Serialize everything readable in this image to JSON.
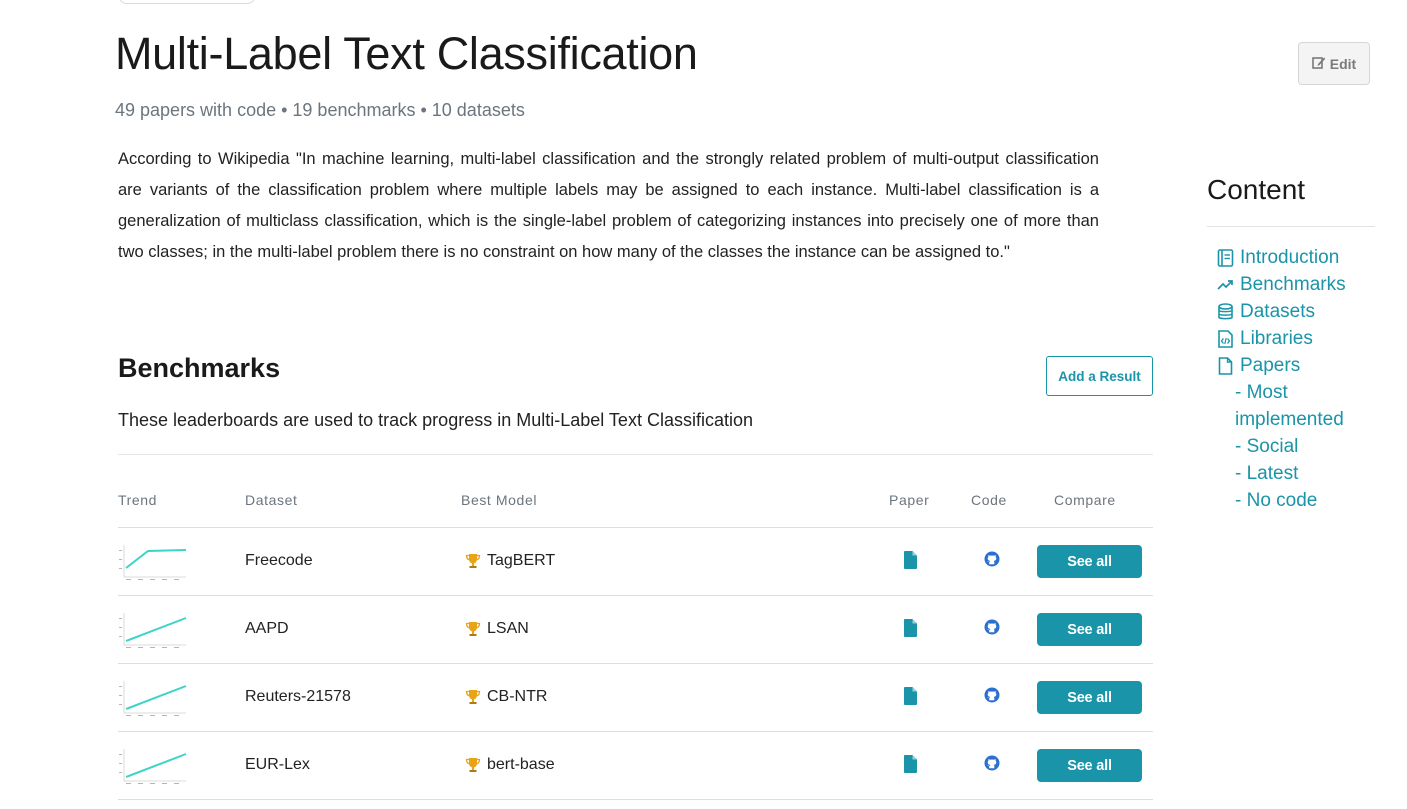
{
  "page": {
    "title": "Multi-Label Text Classification",
    "subtitle": "49 papers with code • 19 benchmarks • 10 datasets",
    "edit_label": "Edit",
    "description": "According to Wikipedia \"In machine learning, multi-label classification and the strongly related problem of multi-output classification are variants of the classification problem where multiple labels may be assigned to each instance. Multi-label classification is a generalization of multiclass classification, which is the single-label problem of categorizing instances into precisely one of more than two classes; in the multi-label problem there is no constraint on how many of the classes the instance can be assigned to.\""
  },
  "benchmarks": {
    "title": "Benchmarks",
    "add_result_label": "Add a Result",
    "description": "These leaderboards are used to track progress in Multi-Label Text Classification",
    "columns": {
      "trend": "Trend",
      "dataset": "Dataset",
      "best_model": "Best Model",
      "paper": "Paper",
      "code": "Code",
      "compare": "Compare"
    },
    "rows": [
      {
        "dataset": "Freecode",
        "model": "TagBERT",
        "compare": "See all",
        "trend_shape": "step"
      },
      {
        "dataset": "AAPD",
        "model": "LSAN",
        "compare": "See all",
        "trend_shape": "rising"
      },
      {
        "dataset": "Reuters-21578",
        "model": "CB-NTR",
        "compare": "See all",
        "trend_shape": "rising"
      },
      {
        "dataset": "EUR-Lex",
        "model": "bert-base",
        "compare": "See all",
        "trend_shape": "rising"
      }
    ],
    "icons": {
      "paper": "file-icon",
      "code": "github-icon",
      "model": "trophy-icon"
    }
  },
  "toc": {
    "title": "Content",
    "items": [
      {
        "label": "Introduction",
        "icon": "book-icon"
      },
      {
        "label": "Benchmarks",
        "icon": "trend-icon"
      },
      {
        "label": "Datasets",
        "icon": "database-icon"
      },
      {
        "label": "Libraries",
        "icon": "code-file-icon"
      },
      {
        "label": "Papers",
        "icon": "file-outline-icon"
      }
    ],
    "sub_items": [
      "- Most implemented",
      "- Social",
      "- Latest",
      "- No code"
    ]
  },
  "colors": {
    "accent": "#1a94a8",
    "trend_line": "#3dd4c8",
    "paper_icon": "#1a94a8",
    "github_icon": "#2b6fd1",
    "trophy": "#e8a317"
  }
}
